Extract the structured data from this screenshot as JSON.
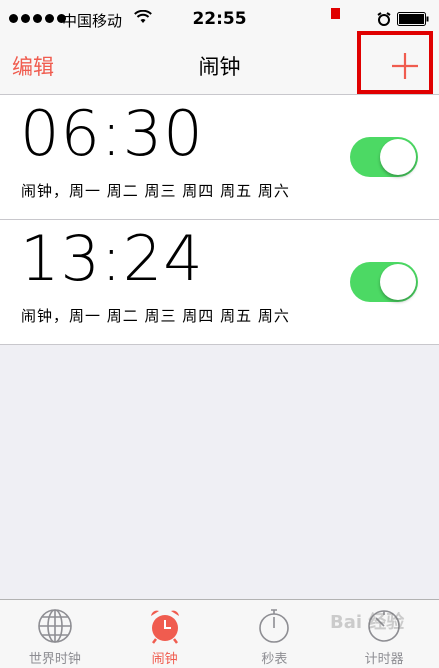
{
  "status_bar": {
    "carrier": "中国移动",
    "time": "22:55"
  },
  "nav": {
    "edit_label": "编辑",
    "title": "闹钟",
    "add_icon": "plus-icon"
  },
  "alarms": [
    {
      "time": "06:30",
      "subtitle": "闹钟，周一 周二 周三 周四 周五 周六",
      "enabled": true
    },
    {
      "time": "13:24",
      "subtitle": "闹钟，周一 周二 周三 周四 周五 周六",
      "enabled": true
    }
  ],
  "tabs": [
    {
      "label": "世界时钟",
      "icon": "globe-icon",
      "active": false
    },
    {
      "label": "闹钟",
      "icon": "alarm-clock-icon",
      "active": true
    },
    {
      "label": "秒表",
      "icon": "stopwatch-icon",
      "active": false
    },
    {
      "label": "计时器",
      "icon": "timer-icon",
      "active": false
    }
  ],
  "watermark": "Bai 经验",
  "colors": {
    "accent": "#f05c4f",
    "toggle_on": "#4cd964",
    "highlight": "#e00000"
  }
}
